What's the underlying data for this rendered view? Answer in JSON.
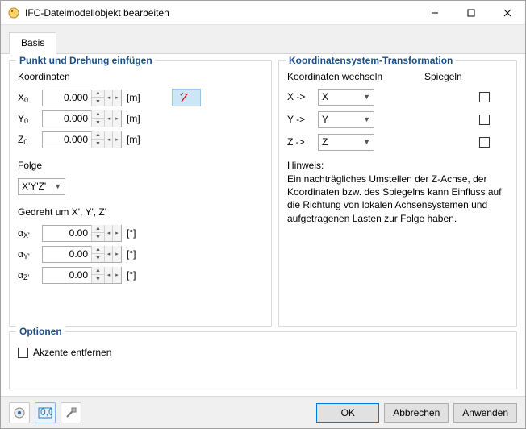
{
  "window": {
    "title": "IFC-Dateimodellobjekt bearbeiten"
  },
  "tabs": {
    "basis": "Basis"
  },
  "groups": {
    "insert": {
      "title": "Punkt und Drehung einfügen",
      "coord_label": "Koordinaten",
      "x_label": "X",
      "x_sub": "0",
      "x_value": "0.000",
      "x_unit": "[m]",
      "y_label": "Y",
      "y_sub": "0",
      "y_value": "0.000",
      "y_unit": "[m]",
      "z_label": "Z",
      "z_sub": "0",
      "z_value": "0.000",
      "z_unit": "[m]",
      "folge_label": "Folge",
      "folge_value": "X'Y'Z'",
      "rotated_label": "Gedreht um X', Y', Z'",
      "ax_label": "α",
      "ax_sub": "X'",
      "ax_value": "0.00",
      "ax_unit": "[°]",
      "ay_label": "α",
      "ay_sub": "Y'",
      "ay_value": "0.00",
      "ay_unit": "[°]",
      "az_label": "α",
      "az_sub": "Z'",
      "az_value": "0.00",
      "az_unit": "[°]"
    },
    "transform": {
      "title": "Koordinatensystem-Transformation",
      "swap_head": "Koordinaten wechseln",
      "mirror_head": "Spiegeln",
      "x_arrow": "X ->",
      "x_sel": "X",
      "y_arrow": "Y ->",
      "y_sel": "Y",
      "z_arrow": "Z ->",
      "z_sel": "Z",
      "hint_title": "Hinweis:",
      "hint_body": "Ein nachträgliches Umstellen der Z-Achse, der Koordinaten bzw. des Spiegelns kann Einfluss auf die Richtung von lokalen Achsensystemen und aufgetragenen Lasten zur Folge haben."
    },
    "options": {
      "title": "Optionen",
      "remove_accents": "Akzente entfernen"
    }
  },
  "footer": {
    "ok": "OK",
    "cancel": "Abbrechen",
    "apply": "Anwenden"
  }
}
